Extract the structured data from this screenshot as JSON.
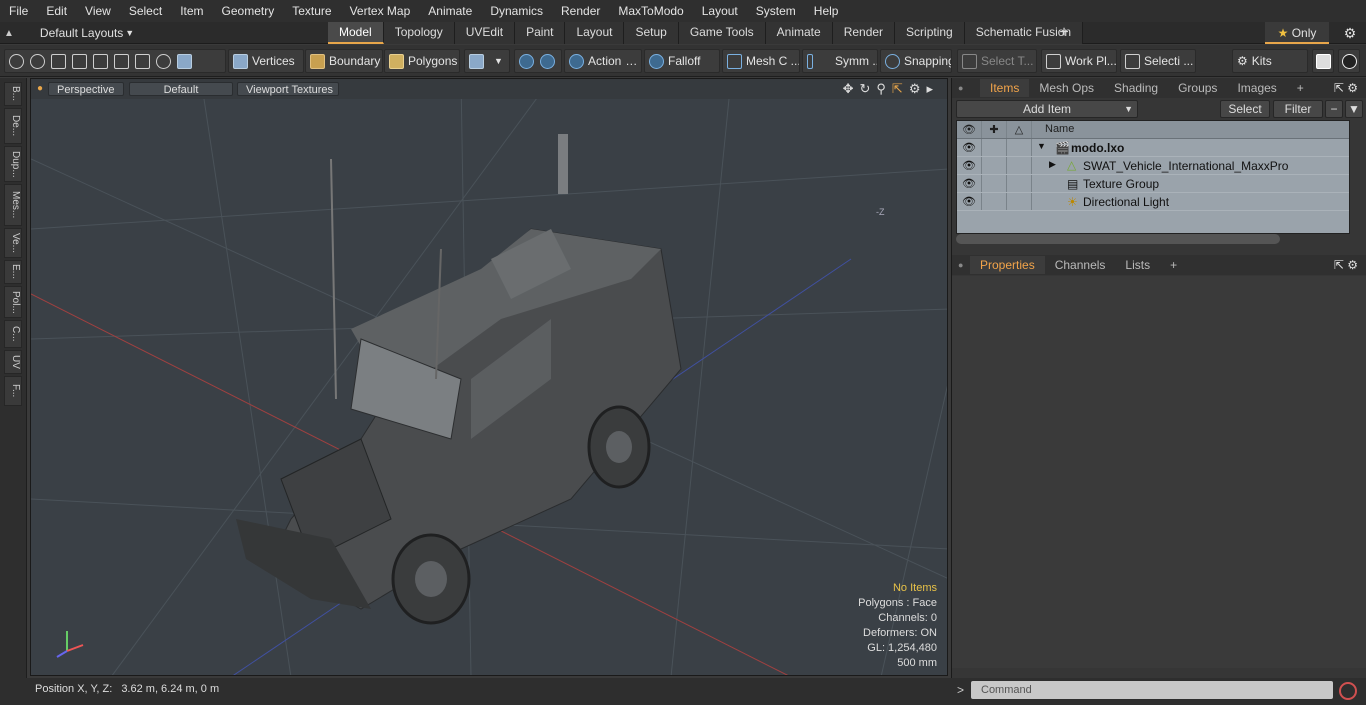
{
  "menu": [
    "File",
    "Edit",
    "View",
    "Select",
    "Item",
    "Geometry",
    "Texture",
    "Vertex Map",
    "Animate",
    "Dynamics",
    "Render",
    "MaxToModo",
    "Layout",
    "System",
    "Help"
  ],
  "layouts_label": "Default Layouts",
  "mode_tabs": [
    "Model",
    "Topology",
    "UVEdit",
    "Paint",
    "Layout",
    "Setup",
    "Game Tools",
    "Animate",
    "Render",
    "Scripting",
    "Schematic Fusion"
  ],
  "only_label": "Only",
  "toolbar": {
    "vertices": "Vertices",
    "boundary": "Boundary",
    "polygons": "Polygons",
    "action": "Action",
    "falloff": "Falloff",
    "mesh": "Mesh C ...",
    "symm": "Symm ...",
    "snapping": "Snapping",
    "select_t": "Select T...",
    "work_pl": "Work Pl...",
    "selecti": "Selecti ...",
    "kits": "Kits"
  },
  "left_tabs": [
    "B...",
    "De...",
    "Dup...",
    "Mes...",
    "Ve...",
    "E...",
    "Pol...",
    "C...",
    "UV",
    "F..."
  ],
  "viewport": {
    "perspective": "Perspective",
    "default": "Default",
    "textures": "Viewport Textures",
    "axis_label": "-Z",
    "stats": {
      "no_items": "No Items",
      "polygons": "Polygons : Face",
      "channels": "Channels: 0",
      "deformers": "Deformers: ON",
      "gl": "GL: 1,254,480",
      "scale": "500 mm"
    }
  },
  "items_panel": {
    "tabs": [
      "Items",
      "Mesh Ops",
      "Shading",
      "Groups",
      "Images"
    ],
    "add_item": "Add Item",
    "select": "Select",
    "filter": "Filter",
    "name_col": "Name",
    "rows": [
      {
        "name": "modo.lxo"
      },
      {
        "name": "SWAT_Vehicle_International_MaxxPro"
      },
      {
        "name": "Texture Group"
      },
      {
        "name": "Directional Light"
      }
    ]
  },
  "props_panel": {
    "tabs": [
      "Properties",
      "Channels",
      "Lists"
    ]
  },
  "status": {
    "position_label": "Position X, Y, Z:",
    "position_value": "3.62 m, 6.24 m, 0 m"
  },
  "command_placeholder": "Command"
}
